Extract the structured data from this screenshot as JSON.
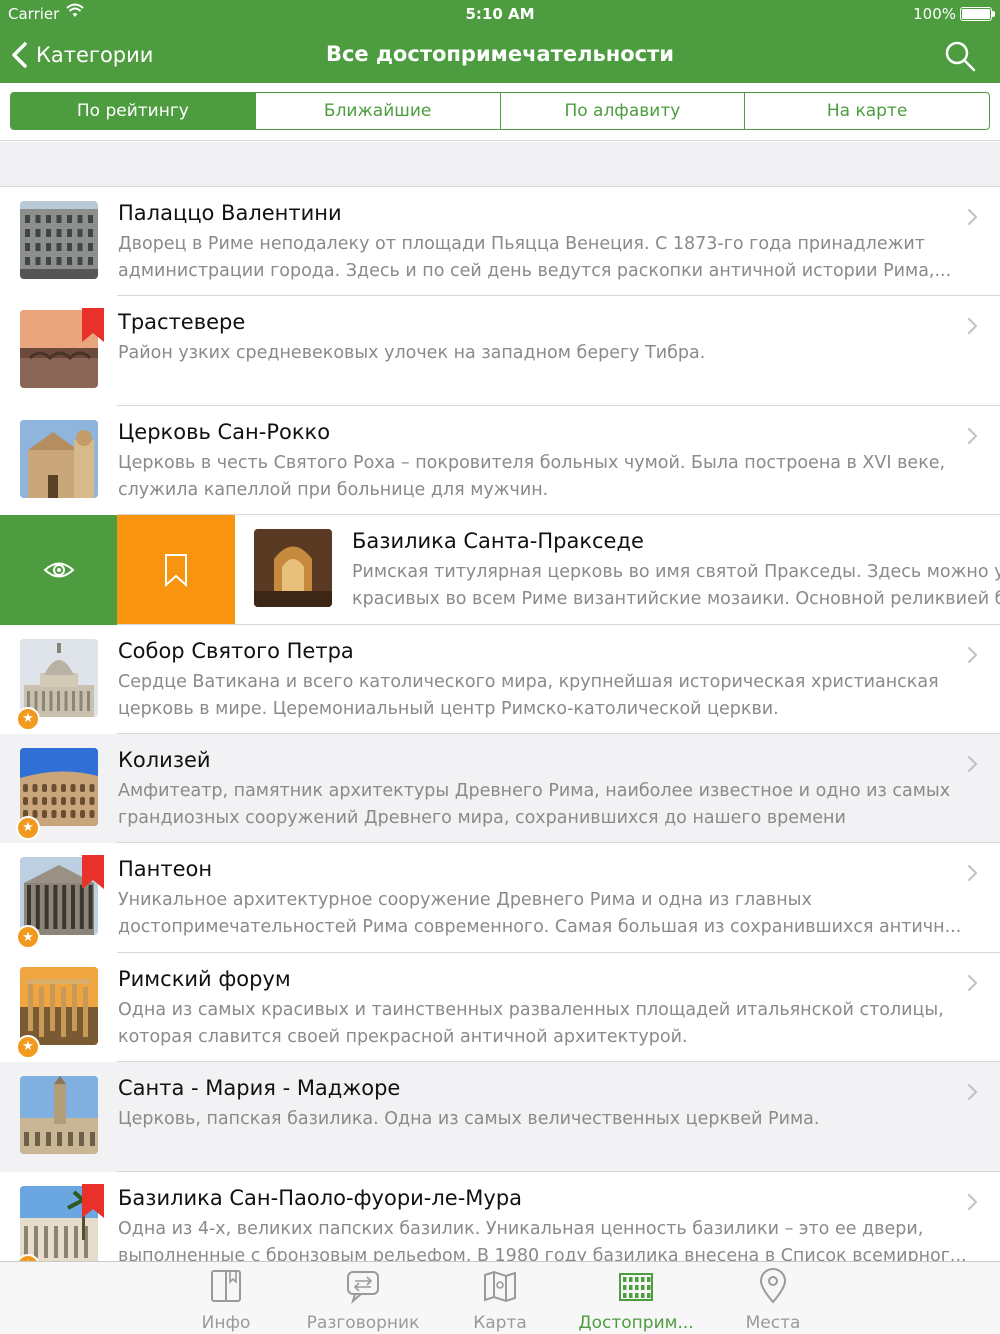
{
  "status_bar": {
    "carrier": "Carrier",
    "time": "5:10 AM",
    "battery": "100%"
  },
  "nav": {
    "back_label": "Категории",
    "title": "Все достопримечательности"
  },
  "segments": [
    {
      "label": "По рейтингу",
      "active": true
    },
    {
      "label": "Ближайшие",
      "active": false
    },
    {
      "label": "По алфавиту",
      "active": false
    },
    {
      "label": "На карте",
      "active": false
    }
  ],
  "items": [
    {
      "name": "Палаццо Валентини",
      "desc": "Дворец в Риме неподалеку от площади Пьяцца Венеция. С 1873-го года принадлежит администрации города. Здесь и по сей день ведутся раскопки античной истории Рима,...",
      "bookmarked": false,
      "starred": false,
      "grey": false,
      "thumb": "building-facade"
    },
    {
      "name": "Трастевере",
      "desc": "Район узких средневековых улочек на западном берегу Тибра.",
      "bookmarked": true,
      "starred": false,
      "grey": false,
      "thumb": "river-bridge"
    },
    {
      "name": "Церковь Сан-Рокко",
      "desc": "Церковь в честь Святого Роха – покровителя больных чумой. Была построена в XVI веке, служила капеллой при больнице для мужчин.",
      "bookmarked": false,
      "starred": false,
      "grey": false,
      "thumb": "church"
    },
    {
      "name": "Базилика Санта-Пракседе",
      "desc": "Римская титулярная церковь во имя святой Пракседы. Здесь можно увидеть одни из самых красивых во всем Риме византийские мозаики. Основной реликвией базилики является...",
      "bookmarked": false,
      "starred": false,
      "grey": false,
      "swiped": true,
      "thumb": "basilica-interior"
    },
    {
      "name": "Собор Святого Петра",
      "desc": "Сердце Ватикана и всего католического мира, крупнейшая историческая христианская церковь в мире. Церемониальный центр Римско-католической церкви.",
      "bookmarked": false,
      "starred": true,
      "grey": false,
      "thumb": "dome"
    },
    {
      "name": "Колизей",
      "desc": "Амфитеатр, памятник архитектуры Древнего Рима, наиболее известное и одно из самых грандиозных сооружений Древнего мира, сохранившихся до нашего времени",
      "bookmarked": false,
      "starred": true,
      "grey": true,
      "thumb": "colosseum"
    },
    {
      "name": "Пантеон",
      "desc": "Уникальное архитектурное сооружение Древнего Рима и одна из главных достопримечательностей Рима современного. Самая большая из сохранившихся античн...",
      "bookmarked": true,
      "starred": true,
      "grey": false,
      "thumb": "pantheon"
    },
    {
      "name": "Римский форум",
      "desc": "Одна из самых красивых и таинственных разваленных площадей итальянской столицы, которая славится своей прекрасной античной архитектурой.",
      "bookmarked": false,
      "starred": true,
      "grey": false,
      "thumb": "forum"
    },
    {
      "name": "Санта - Мария - Маджоре",
      "desc": "Церковь, папская базилика. Одна из самых величественных церквей Рима.",
      "bookmarked": false,
      "starred": false,
      "grey": true,
      "thumb": "basilica-tower"
    },
    {
      "name": "Базилика Сан-Паоло-фуори-ле-Мура",
      "desc": "Одна из 4-х, великих папских базилик. Уникальная ценность базилики – это ее двери, выполненные с бронзовым рельефом. В 1980 году базилика внесена в Список всемирног...",
      "bookmarked": true,
      "starred": true,
      "grey": false,
      "thumb": "palm-basilica"
    }
  ],
  "tabs": [
    {
      "label": "Инфо",
      "icon": "book-icon",
      "active": false
    },
    {
      "label": "Разговорник",
      "icon": "chat-icon",
      "active": false
    },
    {
      "label": "Карта",
      "icon": "map-icon",
      "active": false
    },
    {
      "label": "Достоприм...",
      "icon": "colosseum-icon",
      "active": true
    },
    {
      "label": "Места",
      "icon": "pin-icon",
      "active": false
    }
  ],
  "colors": {
    "brand": "#4d9c3f",
    "bookmark": "#e8312a",
    "swipe_bookmark": "#f8940f",
    "star": "#f29a1f"
  }
}
